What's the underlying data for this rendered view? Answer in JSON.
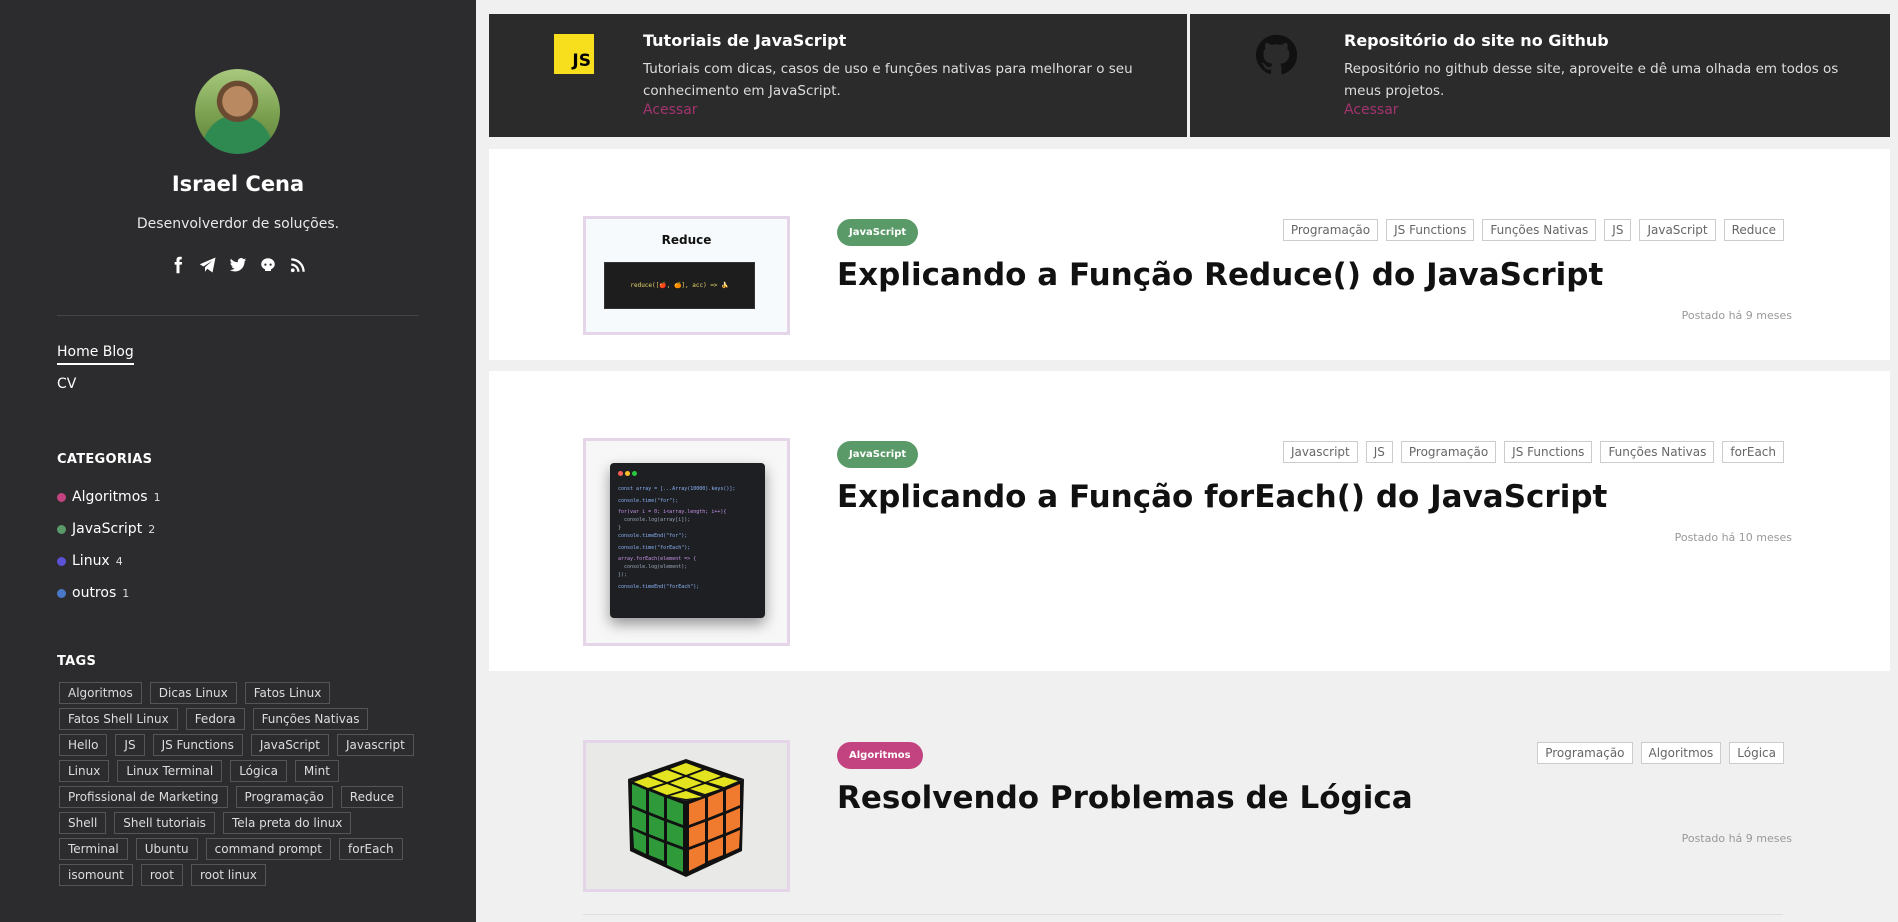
{
  "sidebar": {
    "name": "Israel Cena",
    "tagline": "Desenvolverdor de soluções.",
    "social_icons": [
      "facebook-icon",
      "telegram-icon",
      "twitter-icon",
      "github-icon",
      "rss-icon"
    ],
    "nav": {
      "home": "Home Blog",
      "cv": "CV"
    },
    "categories_title": "CATEGORIAS",
    "categories": [
      {
        "label": "Algoritmos",
        "count": "1",
        "color": "#c2437f"
      },
      {
        "label": "JavaScript",
        "count": "2",
        "color": "#5a9a68"
      },
      {
        "label": "Linux",
        "count": "4",
        "color": "#5b52d6"
      },
      {
        "label": "outros",
        "count": "1",
        "color": "#4a78c8"
      }
    ],
    "tags_title": "TAGS",
    "tags": [
      "Algoritmos",
      "Dicas Linux",
      "Fatos Linux",
      "Fatos Shell Linux",
      "Fedora",
      "Funções Nativas",
      "Hello",
      "JS",
      "JS Functions",
      "JavaScript",
      "Javascript",
      "Linux",
      "Linux Terminal",
      "Lógica",
      "Mint",
      "Profissional de Marketing",
      "Programação",
      "Reduce",
      "Shell",
      "Shell tutoriais",
      "Tela preta do linux",
      "Terminal",
      "Ubuntu",
      "command prompt",
      "forEach",
      "isomount",
      "root",
      "root linux"
    ]
  },
  "top_cards": [
    {
      "title": "Tutoriais de JavaScript",
      "description": "Tutoriais com dicas, casos de uso e funções nativas para melhorar o seu conhecimento em JavaScript.",
      "link": "Acessar",
      "icon": "javascript-logo-icon",
      "icon_text": "JS"
    },
    {
      "title": "Repositório do site no Github",
      "description": "Repositório no github desse site, aproveite e dê uma olhada em todos os meus projetos.",
      "link": "Acessar",
      "icon": "github-icon"
    }
  ],
  "posts": [
    {
      "category": "JavaScript",
      "category_color": "#5a9a68",
      "title": "Explicando a Função Reduce() do JavaScript",
      "tags": [
        "Programação",
        "JS Functions",
        "Funções Nativas",
        "JS",
        "JavaScript",
        "Reduce"
      ],
      "date": "Postado há 9 meses",
      "thumb_title": "Reduce"
    },
    {
      "category": "JavaScript",
      "category_color": "#5a9a68",
      "title": "Explicando a Função forEach() do JavaScript",
      "tags": [
        "Javascript",
        "JS",
        "Programação",
        "JS Functions",
        "Funções Nativas",
        "forEach"
      ],
      "date": "Postado há 10 meses"
    },
    {
      "category": "Algoritmos",
      "category_color": "#c2437f",
      "title": "Resolvendo Problemas de Lógica",
      "tags": [
        "Programação",
        "Algoritmos",
        "Lógica"
      ],
      "date": "Postado há 9 meses"
    }
  ]
}
